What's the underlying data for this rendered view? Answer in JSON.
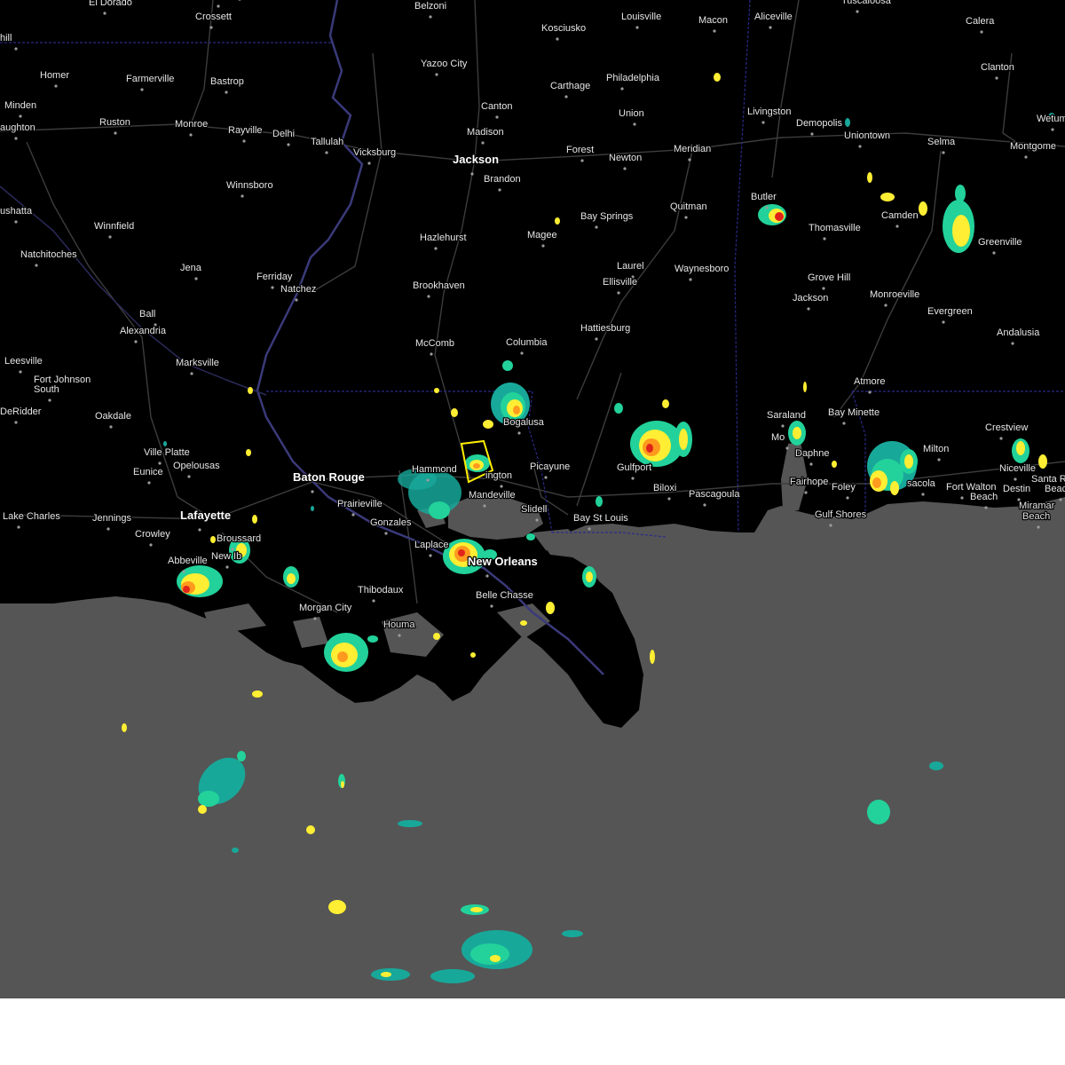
{
  "map": {
    "colors": {
      "land": "#000000",
      "water": "#555555",
      "roads": "#3c3c3c",
      "state_border": "#2a2a8a",
      "warning_polygon": "#ffee00",
      "radar_light": "#18a89a",
      "radar_mid": "#22d29a",
      "radar_yellow": "#ffee33",
      "radar_orange": "#ff9a1e",
      "radar_red": "#e0241a"
    },
    "cities": [
      {
        "id": "el-dorado",
        "name": "El Dorado"
      },
      {
        "id": "crossett",
        "name": "Crossett"
      },
      {
        "id": "hamburg",
        "name": "Hamburg"
      },
      {
        "id": "belzoni",
        "name": "Belzoni"
      },
      {
        "id": "kosciusko",
        "name": "Kosciusko"
      },
      {
        "id": "louisville",
        "name": "Louisville"
      },
      {
        "id": "macon",
        "name": "Macon"
      },
      {
        "id": "aliceville",
        "name": "Aliceville"
      },
      {
        "id": "tuscaloosa",
        "name": "Tuscaloosa"
      },
      {
        "id": "hill",
        "name": "hill"
      },
      {
        "id": "calera",
        "name": "Calera"
      },
      {
        "id": "yazoo-city",
        "name": "Yazoo City"
      },
      {
        "id": "homer",
        "name": "Homer"
      },
      {
        "id": "farmerville",
        "name": "Farmerville"
      },
      {
        "id": "bastrop",
        "name": "Bastrop"
      },
      {
        "id": "carthage",
        "name": "Carthage"
      },
      {
        "id": "philadelphia",
        "name": "Philadelphia"
      },
      {
        "id": "clanton",
        "name": "Clanton"
      },
      {
        "id": "minden",
        "name": "Minden"
      },
      {
        "id": "canton",
        "name": "Canton"
      },
      {
        "id": "union",
        "name": "Union"
      },
      {
        "id": "livingston",
        "name": "Livingston"
      },
      {
        "id": "wetumpka",
        "name": "Wetum"
      },
      {
        "id": "ruston",
        "name": "Ruston"
      },
      {
        "id": "monroe",
        "name": "Monroe"
      },
      {
        "id": "rayville",
        "name": "Rayville"
      },
      {
        "id": "delhi",
        "name": "Delhi"
      },
      {
        "id": "madison",
        "name": "Madison"
      },
      {
        "id": "demopolis",
        "name": "Demopolis"
      },
      {
        "id": "shreveport",
        "name": "aughton"
      },
      {
        "id": "tallulah",
        "name": "Tallulah"
      },
      {
        "id": "uniontown",
        "name": "Uniontown"
      },
      {
        "id": "selma",
        "name": "Selma"
      },
      {
        "id": "montgomery",
        "name": "Montgome"
      },
      {
        "id": "vicksburg",
        "name": "Vicksburg"
      },
      {
        "id": "forest",
        "name": "Forest"
      },
      {
        "id": "newton",
        "name": "Newton"
      },
      {
        "id": "meridian",
        "name": "Meridian"
      },
      {
        "id": "jackson",
        "name": "Jackson"
      },
      {
        "id": "brandon",
        "name": "Brandon"
      },
      {
        "id": "winnsboro",
        "name": "Winnsboro"
      },
      {
        "id": "butler",
        "name": "Butler"
      },
      {
        "id": "quitman",
        "name": "Quitman"
      },
      {
        "id": "camden",
        "name": "Camden"
      },
      {
        "id": "bay-springs",
        "name": "Bay Springs"
      },
      {
        "id": "coushatta",
        "name": "ushatta"
      },
      {
        "id": "winnfield",
        "name": "Winnfield"
      },
      {
        "id": "thomasville",
        "name": "Thomasville"
      },
      {
        "id": "greenville",
        "name": "Greenville"
      },
      {
        "id": "hazlehurst",
        "name": "Hazlehurst"
      },
      {
        "id": "magee",
        "name": "Magee"
      },
      {
        "id": "natchitoches",
        "name": "Natchitoches"
      },
      {
        "id": "laurel",
        "name": "Laurel"
      },
      {
        "id": "waynesboro",
        "name": "Waynesboro"
      },
      {
        "id": "jena",
        "name": "Jena"
      },
      {
        "id": "ferriday",
        "name": "Ferriday"
      },
      {
        "id": "ellisville",
        "name": "Ellisville"
      },
      {
        "id": "grove-hill",
        "name": "Grove Hill"
      },
      {
        "id": "natchez",
        "name": "Natchez"
      },
      {
        "id": "brookhaven",
        "name": "Brookhaven"
      },
      {
        "id": "monroeville",
        "name": "Monroeville"
      },
      {
        "id": "jackson-al",
        "name": "Jackson"
      },
      {
        "id": "ball",
        "name": "Ball"
      },
      {
        "id": "evergreen",
        "name": "Evergreen"
      },
      {
        "id": "alexandria",
        "name": "Alexandria"
      },
      {
        "id": "hattiesburg",
        "name": "Hattiesburg"
      },
      {
        "id": "andalusia",
        "name": "Andalusia"
      },
      {
        "id": "mccomb",
        "name": "McComb"
      },
      {
        "id": "columbia",
        "name": "Columbia"
      },
      {
        "id": "leesville",
        "name": "Leesville"
      },
      {
        "id": "marksville",
        "name": "Marksville"
      },
      {
        "id": "fort-johnson",
        "name": "Fort Johnson"
      },
      {
        "id": "fort-johnson-2",
        "name": "South"
      },
      {
        "id": "atmore",
        "name": "Atmore"
      },
      {
        "id": "deridder",
        "name": "DeRidder"
      },
      {
        "id": "oakdale",
        "name": "Oakdale"
      },
      {
        "id": "bogalusa",
        "name": "Bogalusa"
      },
      {
        "id": "saraland",
        "name": "Saraland"
      },
      {
        "id": "bay-minette",
        "name": "Bay Minette"
      },
      {
        "id": "crestview",
        "name": "Crestview"
      },
      {
        "id": "mobile",
        "name": "Mo"
      },
      {
        "id": "ville-platte",
        "name": "Ville Platte"
      },
      {
        "id": "milton",
        "name": "Milton"
      },
      {
        "id": "opelousas",
        "name": "Opelousas"
      },
      {
        "id": "daphne",
        "name": "Daphne"
      },
      {
        "id": "niceville",
        "name": "Niceville"
      },
      {
        "id": "hammond",
        "name": "Hammond"
      },
      {
        "id": "picayune",
        "name": "Picayune"
      },
      {
        "id": "gulfport",
        "name": "Gulfport"
      },
      {
        "id": "biloxi",
        "name": "Biloxi"
      },
      {
        "id": "pascagoula",
        "name": "Pascagoula"
      },
      {
        "id": "eunice",
        "name": "Eunice"
      },
      {
        "id": "baton-rouge",
        "name": "Baton Rouge"
      },
      {
        "id": "covington",
        "name": "ington"
      },
      {
        "id": "fairhope",
        "name": "Fairhope"
      },
      {
        "id": "foley",
        "name": "Foley"
      },
      {
        "id": "pensacola",
        "name": "sacola"
      },
      {
        "id": "fort-walton",
        "name": "Fort Walton"
      },
      {
        "id": "fort-walton-2",
        "name": "Beach"
      },
      {
        "id": "destin",
        "name": "Destin"
      },
      {
        "id": "santa-rosa",
        "name": "Santa R"
      },
      {
        "id": "santa-rosa-2",
        "name": "Beach"
      },
      {
        "id": "mandeville",
        "name": "Mandeville"
      },
      {
        "id": "prairieville",
        "name": "Prairieville"
      },
      {
        "id": "slidell",
        "name": "Slidell"
      },
      {
        "id": "miramar",
        "name": "Miramar"
      },
      {
        "id": "miramar-2",
        "name": "Beach"
      },
      {
        "id": "lake-charles",
        "name": "Lake Charles"
      },
      {
        "id": "jennings",
        "name": "Jennings"
      },
      {
        "id": "lafayette",
        "name": "Lafayette"
      },
      {
        "id": "gonzales",
        "name": "Gonzales"
      },
      {
        "id": "bay-st-louis",
        "name": "Bay St Louis"
      },
      {
        "id": "gulf-shores",
        "name": "Gulf Shores"
      },
      {
        "id": "crowley",
        "name": "Crowley"
      },
      {
        "id": "broussard",
        "name": "Broussard"
      },
      {
        "id": "laplace",
        "name": "Laplace"
      },
      {
        "id": "new-iberia",
        "name": "New Ib"
      },
      {
        "id": "new-orleans",
        "name": "New Orleans"
      },
      {
        "id": "abbeville",
        "name": "Abbeville"
      },
      {
        "id": "thibodaux",
        "name": "Thibodaux"
      },
      {
        "id": "belle-chasse",
        "name": "Belle Chasse"
      },
      {
        "id": "morgan-city",
        "name": "Morgan City"
      },
      {
        "id": "houma",
        "name": "Houma"
      }
    ]
  }
}
